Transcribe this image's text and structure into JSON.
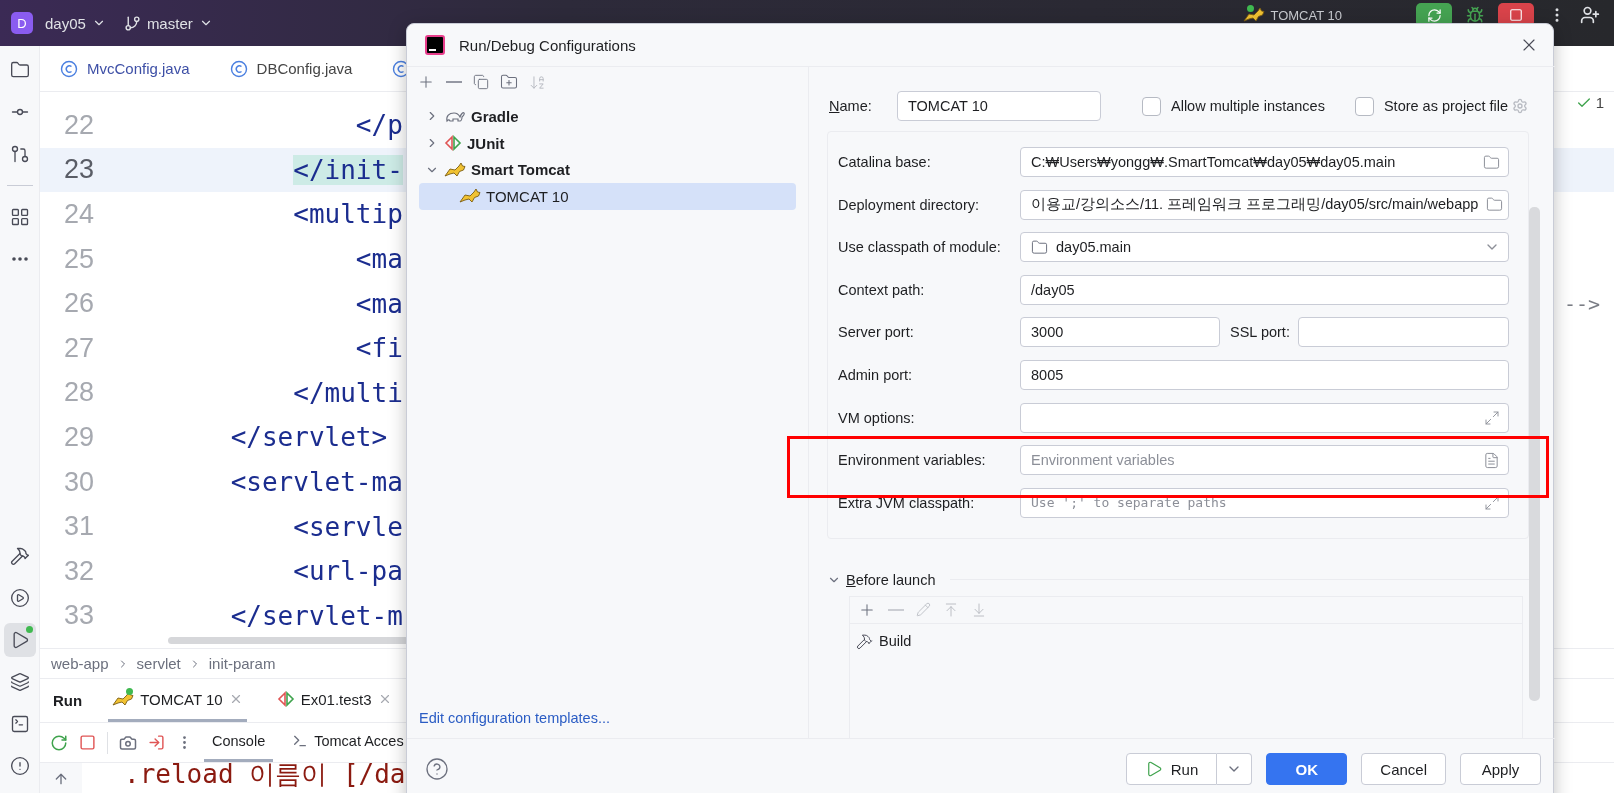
{
  "topbar": {
    "project_badge": "D",
    "project": "day05",
    "branch": "master",
    "run_config": {
      "label": "TOMCAT 10",
      "running": true
    }
  },
  "tool_windows": {
    "top": [
      {
        "kind": "project",
        "selected": false,
        "running": false
      },
      {
        "kind": "commit",
        "selected": false,
        "running": false
      },
      {
        "kind": "pull",
        "selected": false,
        "running": false
      },
      {
        "kind": "structure",
        "selected": false,
        "running": false
      },
      {
        "kind": "more",
        "selected": false,
        "running": false
      }
    ],
    "bottom": [
      {
        "kind": "build",
        "selected": false,
        "running": false
      },
      {
        "kind": "services",
        "selected": false,
        "running": false
      },
      {
        "kind": "run",
        "selected": true,
        "running": true
      },
      {
        "kind": "layers",
        "selected": false,
        "running": false
      },
      {
        "kind": "terminal",
        "selected": false,
        "running": false
      },
      {
        "kind": "problems",
        "selected": false,
        "running": false
      }
    ]
  },
  "editor": {
    "tabs": [
      {
        "kind": "class",
        "label": "MvcConfig.java",
        "color": "#3d4fa6"
      },
      {
        "kind": "class",
        "label": "DBConfig.java",
        "color": "#454545"
      },
      {
        "kind": "class"
      }
    ],
    "inspection": {
      "count": "1"
    },
    "lines": [
      {
        "number": "22",
        "code": "            </p",
        "current": false,
        "matched": false
      },
      {
        "number": "23",
        "code": "        </init-",
        "current": true,
        "matched": true
      },
      {
        "number": "24",
        "code": "        <multip",
        "current": false,
        "matched": false
      },
      {
        "number": "25",
        "code": "            <ma",
        "current": false,
        "matched": false
      },
      {
        "number": "26",
        "code": "            <ma",
        "tail": "-->",
        "current": false,
        "matched": false
      },
      {
        "number": "27",
        "code": "            <fi",
        "current": false,
        "matched": false
      },
      {
        "number": "28",
        "code": "        </multi",
        "current": false,
        "matched": false
      },
      {
        "number": "29",
        "code": "    </servlet>",
        "current": false,
        "matched": false
      },
      {
        "number": "30",
        "code": "    <servlet-ma",
        "current": false,
        "matched": false
      },
      {
        "number": "31",
        "code": "        <servle",
        "current": false,
        "matched": false
      },
      {
        "number": "32",
        "code": "        <url-pa",
        "current": false,
        "matched": false
      },
      {
        "number": "33",
        "code": "    </servlet-m",
        "current": false,
        "matched": false
      }
    ]
  },
  "breadcrumb": [
    "web-app",
    "servlet",
    "init-param"
  ],
  "run_panel": {
    "title": "Run",
    "tabs": [
      {
        "label": "TOMCAT 10",
        "kind": "tomcat",
        "running": true,
        "selected": true
      },
      {
        "label": "Ex01.test3",
        "kind": "junit",
        "running": false,
        "selected": false
      }
    ],
    "console_tabs": [
      {
        "label": "Console",
        "kind": "console",
        "selected": true
      },
      {
        "label": "Tomcat Acces",
        "kind": "terminal",
        "selected": false
      }
    ],
    "output": [
      ".reload 이름이 [/da"
    ]
  },
  "dialog": {
    "title": "Run/Debug Configurations",
    "tree": [
      {
        "label": "Gradle",
        "kind": "gradle",
        "expanded": false,
        "selected": false
      },
      {
        "label": "JUnit",
        "kind": "junit",
        "expanded": false,
        "selected": false
      },
      {
        "label": "Smart Tomcat",
        "kind": "tomcat",
        "expanded": true,
        "selected": false,
        "children": [
          {
            "label": "TOMCAT 10",
            "kind": "tomcat",
            "selected": true
          }
        ]
      }
    ],
    "templates_link": "Edit configuration templates...",
    "name": {
      "label": "Name:",
      "value": "TOMCAT 10"
    },
    "options": [
      {
        "label": "Allow multiple instances",
        "checked": false
      },
      {
        "label": "Store as project file",
        "checked": false
      }
    ],
    "fields": [
      {
        "label": "Catalina base:",
        "kind": "path",
        "value": "C:₩Users₩yongg₩.SmartTomcat₩day05₩day05.main"
      },
      {
        "label": "Deployment directory:",
        "kind": "path",
        "value": "이용교/강의소스/11. 프레임워크 프로그래밍/day05/src/main/webapp"
      },
      {
        "label": "Use classpath of module:",
        "kind": "module",
        "value": "day05.main"
      },
      {
        "label": "Context path:",
        "kind": "text",
        "value": "/day05"
      },
      {
        "label": "Server port:",
        "kind": "pair",
        "value": "3000",
        "second_label": "SSL port:"
      },
      {
        "label": "Admin port:",
        "kind": "text",
        "value": "8005"
      },
      {
        "label": "VM options:",
        "kind": "expand"
      },
      {
        "label": "Environment variables:",
        "kind": "list",
        "placeholder": "Environment variables"
      },
      {
        "label": "Extra JVM classpath:",
        "kind": "expand",
        "placeholder": "Use ';' to separate paths"
      }
    ],
    "before_launch": {
      "title": "Before launch",
      "expanded": true,
      "tasks": [
        {
          "label": "Build"
        }
      ]
    },
    "buttons": [
      {
        "label": "Run",
        "kind": "run"
      },
      {
        "label": "OK",
        "kind": "primary"
      },
      {
        "label": "Cancel",
        "kind": "plain"
      },
      {
        "label": "Apply",
        "kind": "plain"
      }
    ]
  },
  "annotation": {
    "kind": "box"
  }
}
